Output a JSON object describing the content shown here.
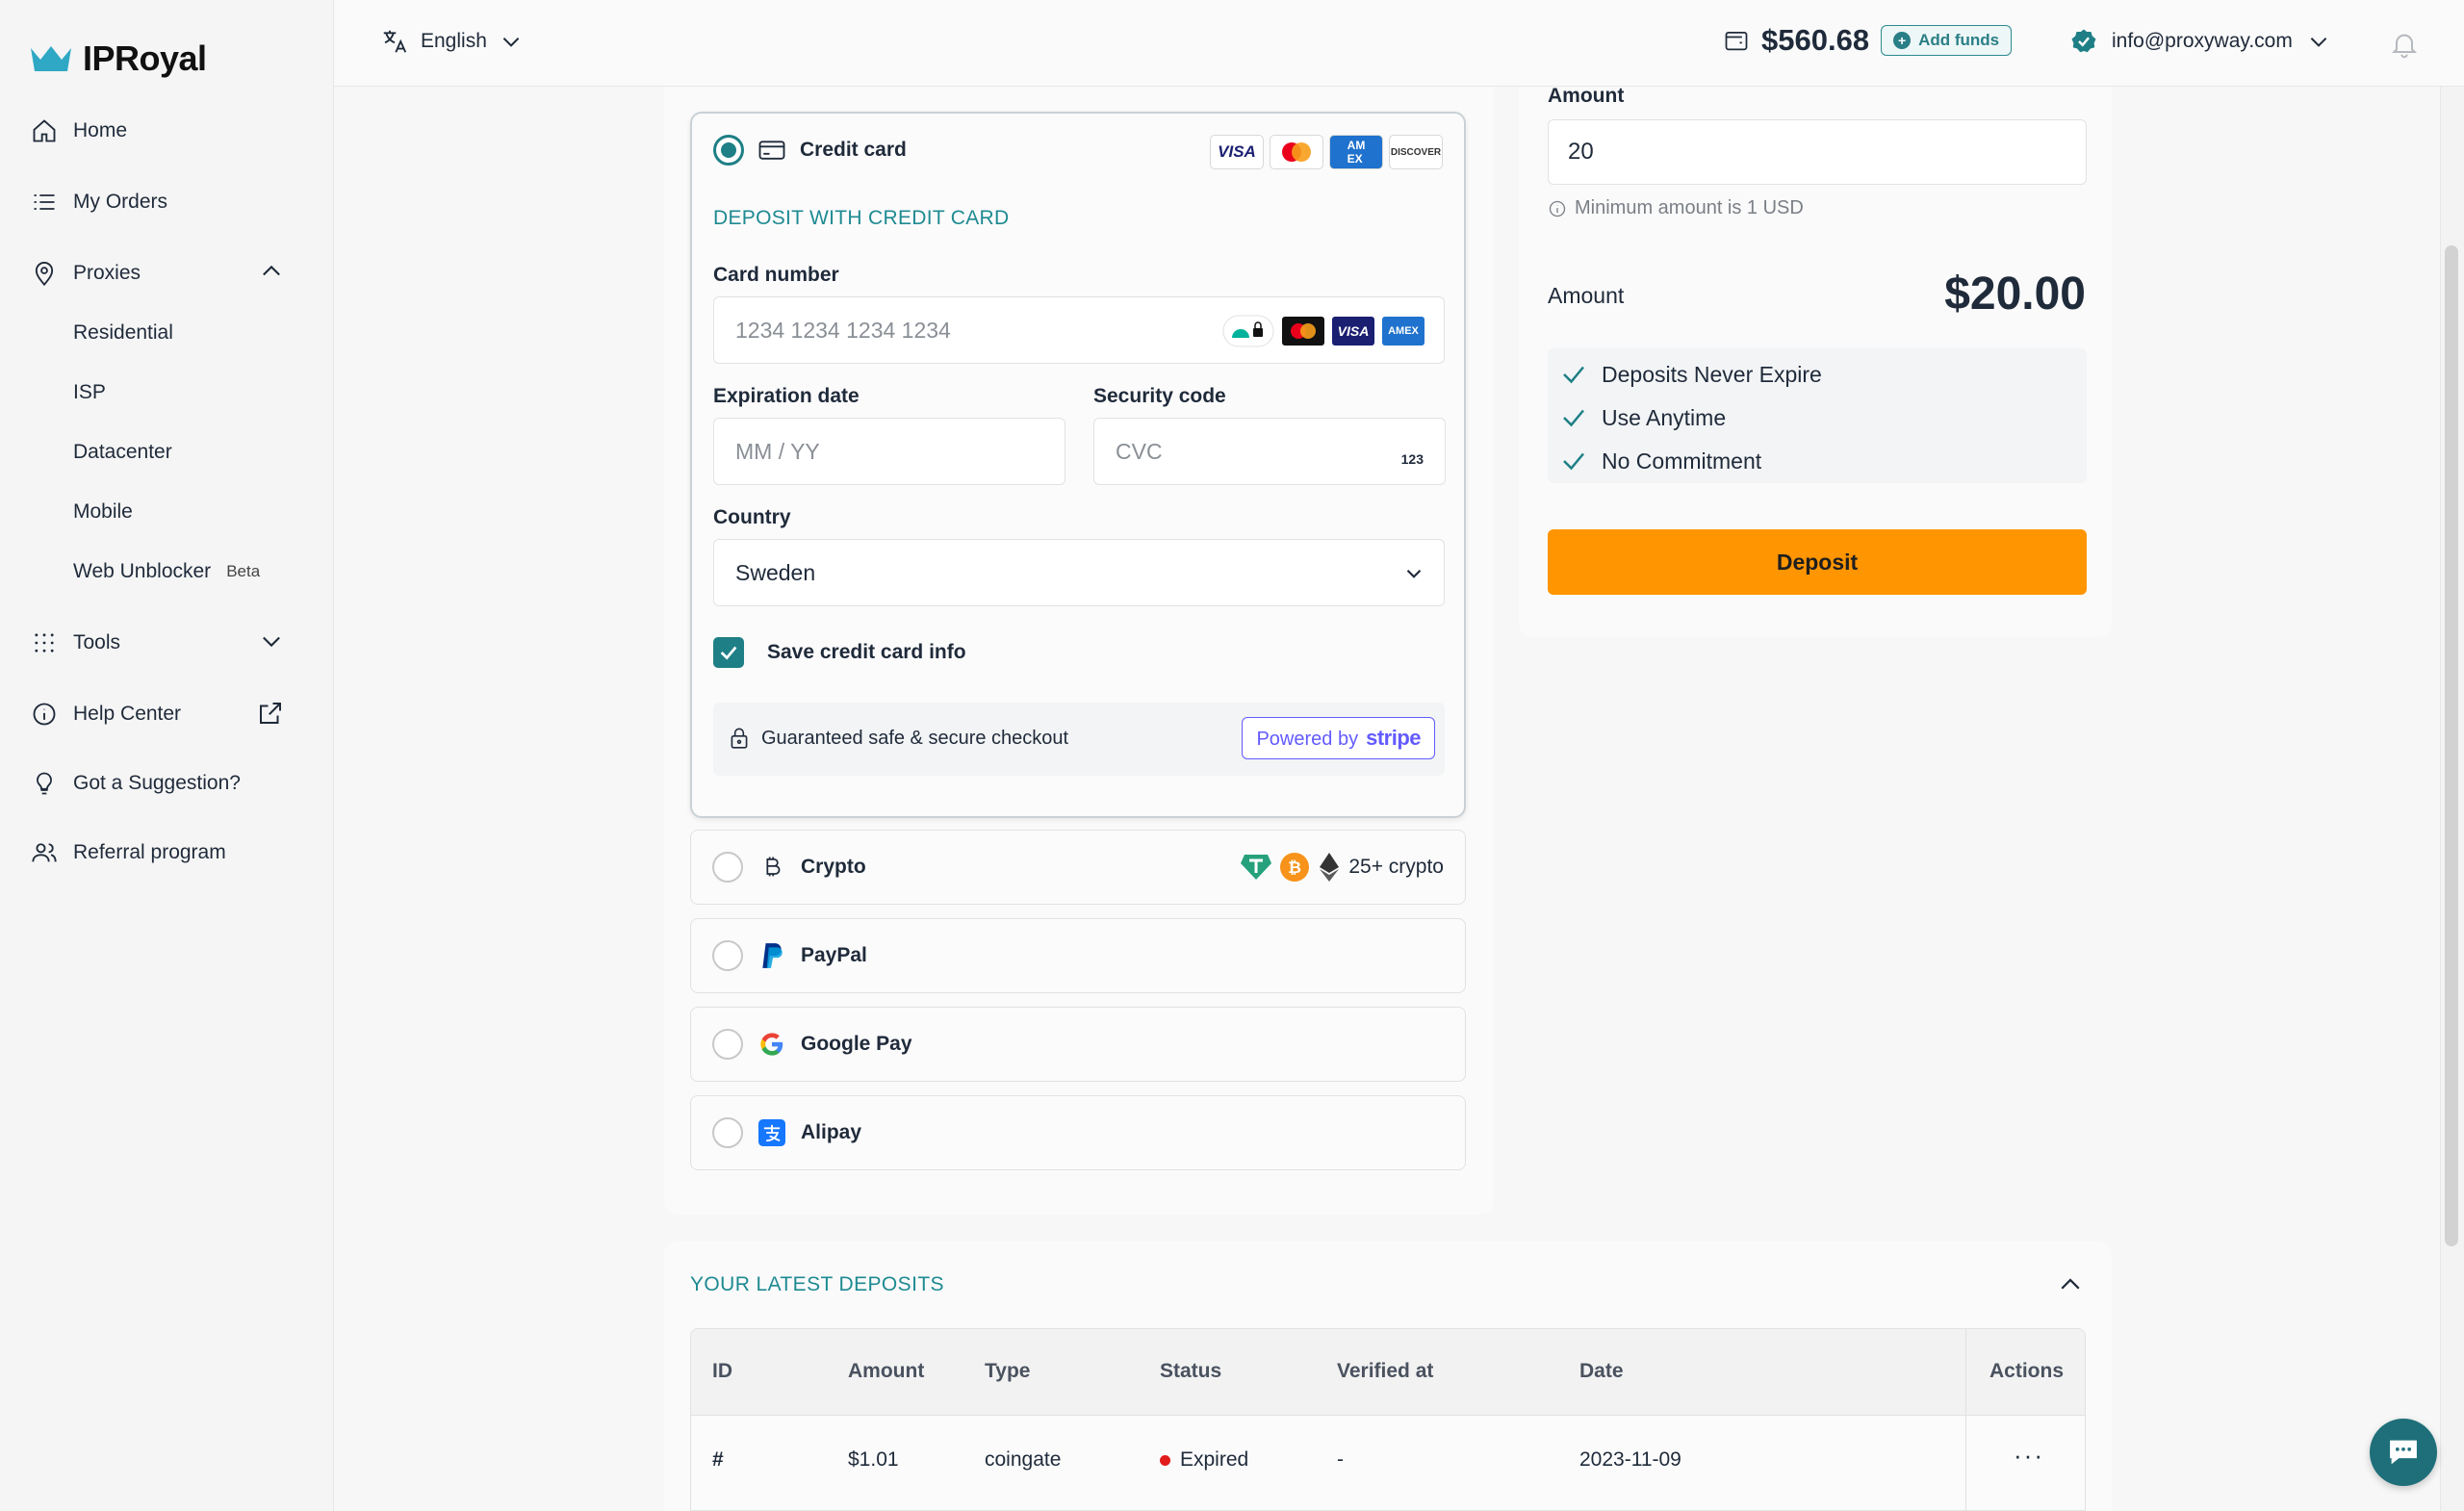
{
  "app": {
    "brand": "IPRoyal"
  },
  "sidebar": {
    "items": [
      {
        "label": "Home",
        "icon": "home-icon"
      },
      {
        "label": "My Orders",
        "icon": "list-icon"
      },
      {
        "label": "Proxies",
        "icon": "location-pin-icon"
      },
      {
        "label": "Tools",
        "icon": "grid-dots-icon"
      },
      {
        "label": "Help Center",
        "icon": "info-icon"
      },
      {
        "label": "Got a Suggestion?",
        "icon": "lightbulb-icon"
      },
      {
        "label": "Referral program",
        "icon": "users-icon"
      }
    ],
    "proxies_sub": [
      "Residential",
      "ISP",
      "Datacenter",
      "Mobile",
      "Web Unblocker"
    ],
    "beta_badge": "Beta"
  },
  "topbar": {
    "language": "English",
    "balance": "$560.68",
    "add_funds": "Add funds",
    "user_email": "info@proxyway.com"
  },
  "payment": {
    "credit_card": {
      "label": "Credit card",
      "brands": [
        "VISA",
        "MC",
        "AMEX",
        "DISCOVER"
      ],
      "section_title": "DEPOSIT WITH CREDIT CARD",
      "card_number_label": "Card number",
      "card_number_placeholder": "1234 1234 1234 1234",
      "expiration_label": "Expiration date",
      "expiration_placeholder": "MM / YY",
      "security_label": "Security code",
      "security_placeholder": "CVC",
      "cvc_hint": "123",
      "country_label": "Country",
      "country_value": "Sweden",
      "save_label": "Save credit card info",
      "secure_text": "Guaranteed safe & secure checkout",
      "powered_by": "Powered by",
      "stripe": "stripe"
    },
    "crypto": {
      "label": "Crypto",
      "note": "25+ crypto"
    },
    "paypal": {
      "label": "PayPal"
    },
    "google_pay": {
      "label": "Google Pay"
    },
    "alipay": {
      "label": "Alipay"
    }
  },
  "summary": {
    "amount_label": "Amount",
    "amount_value": "20",
    "min_note": "Minimum amount is 1 USD",
    "total_label": "Amount",
    "total_value": "$20.00",
    "benefits": [
      "Deposits Never Expire",
      "Use Anytime",
      "No Commitment"
    ],
    "deposit_button": "Deposit"
  },
  "deposits": {
    "title": "YOUR LATEST DEPOSITS",
    "columns": [
      "ID",
      "Amount",
      "Type",
      "Status",
      "Verified at",
      "Date",
      "Actions"
    ],
    "rows": [
      {
        "id": "#",
        "amount": "$1.01",
        "type": "coingate",
        "status": "Expired",
        "verified": "-",
        "date": "2023-11-09",
        "actions": "···"
      }
    ]
  },
  "colors": {
    "accent": "#1e7f86",
    "deposit_button": "#ff9500",
    "status_expired": "#e21b1b"
  }
}
